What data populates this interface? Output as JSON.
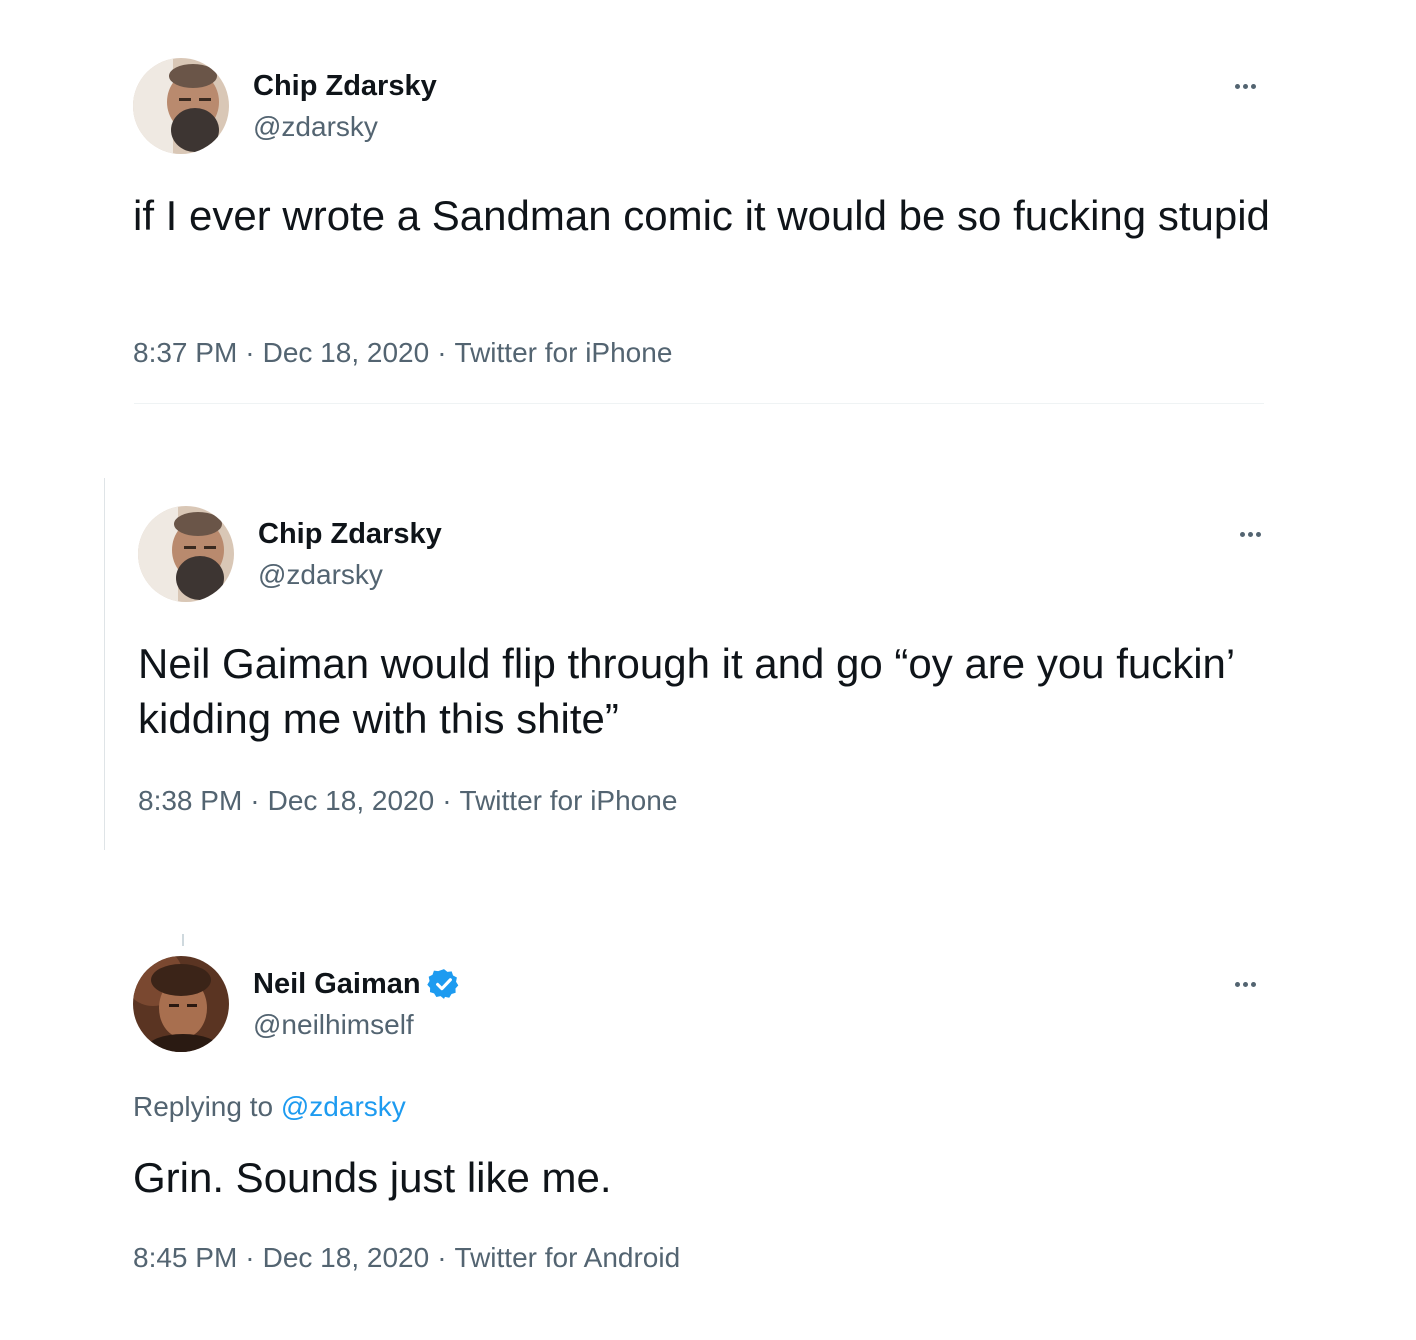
{
  "tweets": [
    {
      "name": "Chip Zdarsky",
      "handle": "@zdarsky",
      "avatar_icon": "bearded-man-avatar",
      "text": "if I ever wrote a Sandman comic it would be so fucking stupid",
      "time": "8:37 PM",
      "date": "Dec 18, 2020",
      "source": "Twitter for iPhone"
    },
    {
      "name": "Chip Zdarsky",
      "handle": "@zdarsky",
      "avatar_icon": "bearded-man-avatar",
      "text": "Neil Gaiman would flip through it and go “oy are you fuckin’ kidding me with this shite”",
      "time": "8:38 PM",
      "date": "Dec 18, 2020",
      "source": "Twitter for iPhone"
    },
    {
      "name": "Neil Gaiman",
      "handle": "@neilhimself",
      "avatar_icon": "portrait-avatar",
      "verified": true,
      "replying_prefix": "Replying to",
      "replying_to": "@zdarsky",
      "text": "Grin. Sounds just like me.",
      "time": "8:45 PM",
      "date": "Dec 18, 2020",
      "source": "Twitter for Android"
    }
  ],
  "separator": "·",
  "colors": {
    "text": "#0f1419",
    "secondary": "#536471",
    "accent": "#1d9bf0",
    "divider": "#eff3f4"
  },
  "icons": {
    "more": "more-options-icon",
    "verified": "verified-badge-icon"
  }
}
